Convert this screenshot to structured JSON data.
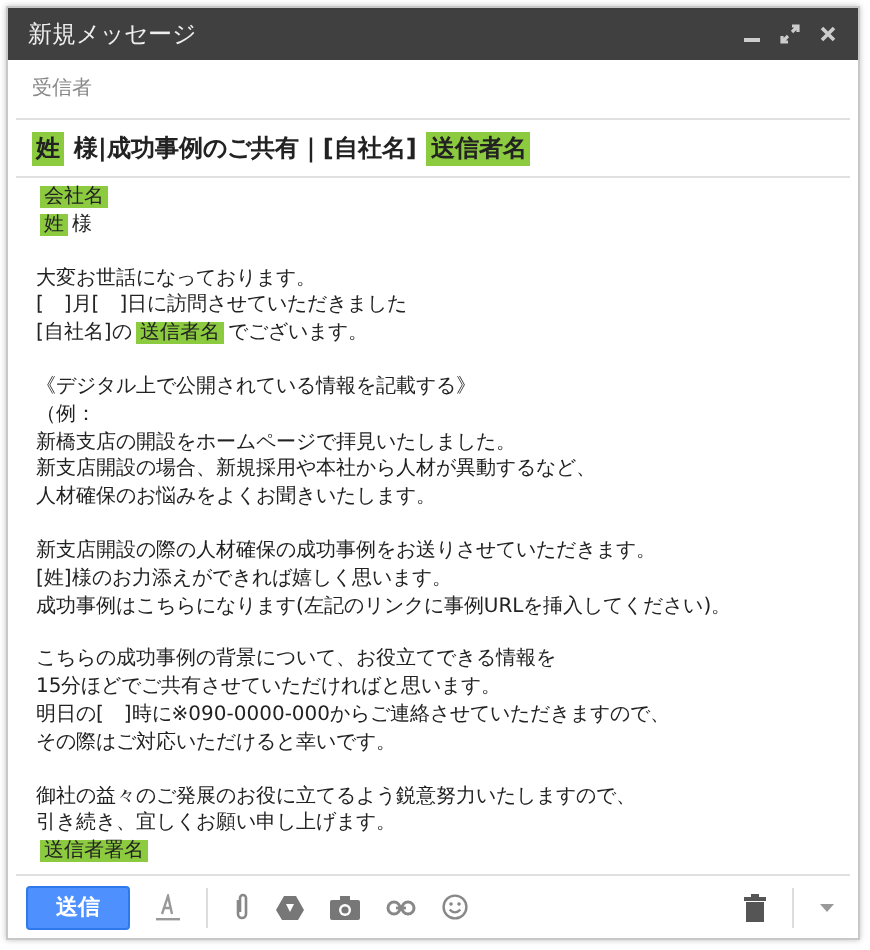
{
  "window": {
    "title": "新規メッセージ"
  },
  "recipients": {
    "placeholder": "受信者"
  },
  "subject": [
    {
      "kind": "tag",
      "text": "姓"
    },
    {
      "kind": "text",
      "text": "様|成功事例のご共有｜[自社名]"
    },
    {
      "kind": "tag",
      "text": "送信者名"
    }
  ],
  "body": [
    [
      [
        {
          "kind": "tag",
          "text": "会社名"
        }
      ],
      [
        {
          "kind": "tag",
          "text": "姓"
        },
        {
          "kind": "text",
          "text": "様"
        }
      ]
    ],
    [
      [
        {
          "kind": "text",
          "text": "大変お世話になっております。"
        }
      ],
      [
        {
          "kind": "text",
          "text": "[　]月[　]日に訪問させていただきました"
        }
      ],
      [
        {
          "kind": "text",
          "text": "[自社名]の"
        },
        {
          "kind": "tag",
          "text": "送信者名"
        },
        {
          "kind": "text",
          "text": "でございます。"
        }
      ]
    ],
    [
      [
        {
          "kind": "text",
          "text": "《デジタル上で公開されている情報を記載する》"
        }
      ],
      [
        {
          "kind": "text",
          "text": "（例："
        }
      ],
      [
        {
          "kind": "text",
          "text": "新橋支店の開設をホームページで拝見いたしました。"
        }
      ],
      [
        {
          "kind": "text",
          "text": "新支店開設の場合、新規採用や本社から人材が異動するなど、"
        }
      ],
      [
        {
          "kind": "text",
          "text": "人材確保のお悩みをよくお聞きいたします。"
        }
      ]
    ],
    [
      [
        {
          "kind": "text",
          "text": "新支店開設の際の人材確保の成功事例をお送りさせていただきます。"
        }
      ],
      [
        {
          "kind": "text",
          "text": "[姓]様のお力添えができれば嬉しく思います。"
        }
      ],
      [
        {
          "kind": "text",
          "text": "成功事例はこちらになります(左記のリンクに事例URLを挿入してください)。"
        }
      ]
    ],
    [
      [
        {
          "kind": "text",
          "text": "こちらの成功事例の背景について、お役立てできる情報を"
        }
      ],
      [
        {
          "kind": "text",
          "text": "15分ほどでご共有させていただければと思います。"
        }
      ],
      [
        {
          "kind": "text",
          "text": "明日の[　]時に※090-0000-000からご連絡させていただきますので、"
        }
      ],
      [
        {
          "kind": "text",
          "text": "その際はご対応いただけると幸いです。"
        }
      ]
    ],
    [
      [
        {
          "kind": "text",
          "text": "御社の益々のご発展のお役に立てるよう鋭意努力いたしますので、"
        }
      ],
      [
        {
          "kind": "text",
          "text": "引き続き、宜しくお願い申し上げます。"
        }
      ],
      [
        {
          "kind": "tag",
          "text": "送信者署名"
        }
      ]
    ]
  ],
  "toolbar": {
    "send": "送信"
  }
}
